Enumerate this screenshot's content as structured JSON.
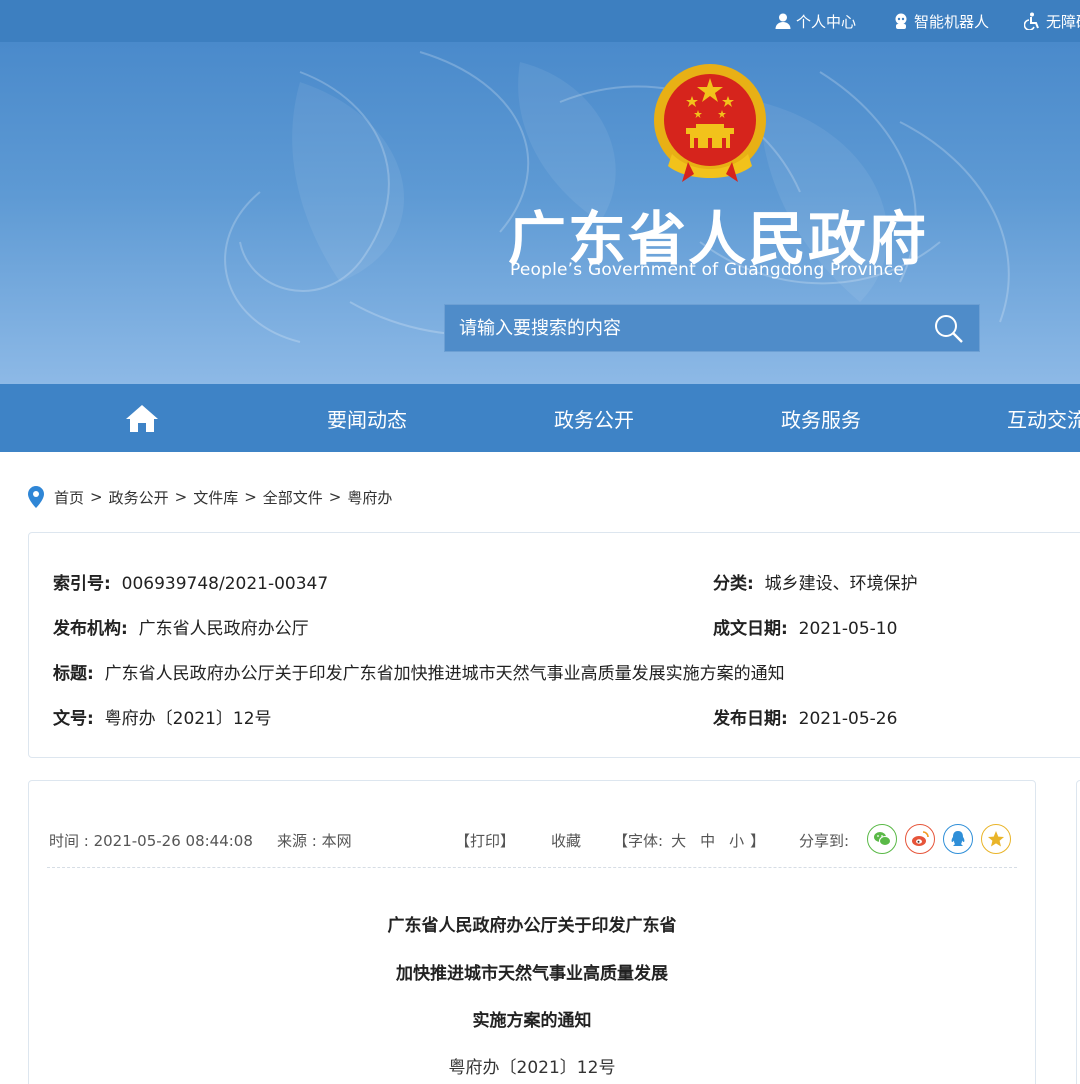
{
  "topbar": {
    "links": [
      "个人中心",
      "智能机器人",
      "无障碍"
    ]
  },
  "header": {
    "title": "广东省人民政府",
    "subtitle": "People’s Government of Guangdong Province",
    "search_placeholder": "请输入要搜索的内容"
  },
  "nav": {
    "items": [
      "要闻动态",
      "政务公开",
      "政务服务",
      "互动交流"
    ]
  },
  "breadcrumb": [
    "首页",
    "政务公开",
    "文件库",
    "全部文件",
    "粤府办"
  ],
  "meta": {
    "index_label": "索引号:",
    "index_value": "006939748/2021-00347",
    "category_label": "分类:",
    "category_value": "城乡建设、环境保护",
    "issuer_label": "发布机构:",
    "issuer_value": "广东省人民政府办公厅",
    "created_label": "成文日期:",
    "created_value": "2021-05-10",
    "title_label": "标题:",
    "title_value": "广东省人民政府办公厅关于印发广东省加快推进城市天然气事业高质量发展实施方案的通知",
    "docno_label": "文号:",
    "docno_value": "粤府办〔2021〕12号",
    "published_label": "发布日期:",
    "published_value": "2021-05-26"
  },
  "article": {
    "time": "时间 : 2021-05-26 08:44:08",
    "source": "来源 : 本网",
    "print": "【打印】",
    "favorite": "收藏",
    "font_label": "【字体:",
    "font_large": "大",
    "font_medium": "中",
    "font_small": "小",
    "font_close": "】",
    "share_label": "分享到:",
    "title_lines": [
      "广东省人民政府办公厅关于印发广东省",
      "加快推进城市天然气事业高质量发展",
      "实施方案的通知"
    ],
    "doc_number": "粤府办〔2021〕12号"
  },
  "colors": {
    "topbar": "#3d7fc0",
    "nav": "#3e83c6",
    "emblem_red": "#d6241c",
    "emblem_gold": "#f2c21b"
  },
  "icons": {
    "user": "user-icon",
    "robot": "robot-icon",
    "accessibility": "accessibility-icon",
    "search": "search-icon",
    "home": "home-icon",
    "location": "location-pin-icon",
    "wechat": "wechat-icon",
    "weibo": "weibo-icon",
    "qq": "qq-icon",
    "qzone": "star-icon"
  }
}
